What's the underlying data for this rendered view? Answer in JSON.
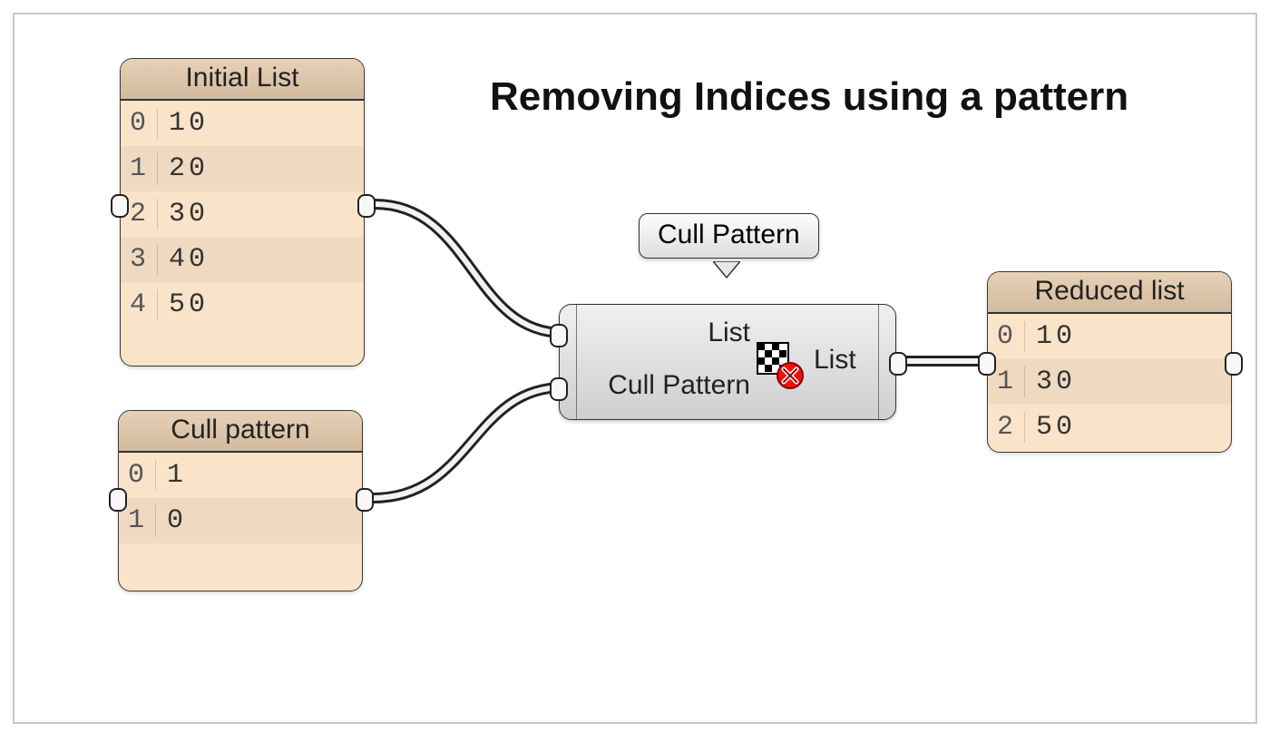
{
  "title": "Removing Indices using a pattern",
  "panels": {
    "initial": {
      "title": "Initial List",
      "rows": [
        {
          "idx": "0",
          "val": "10"
        },
        {
          "idx": "1",
          "val": "20"
        },
        {
          "idx": "2",
          "val": "30"
        },
        {
          "idx": "3",
          "val": "40"
        },
        {
          "idx": "4",
          "val": "50"
        }
      ]
    },
    "cull": {
      "title": "Cull pattern",
      "rows": [
        {
          "idx": "0",
          "val": "1"
        },
        {
          "idx": "1",
          "val": "0"
        }
      ]
    },
    "reduced": {
      "title": "Reduced list",
      "rows": [
        {
          "idx": "0",
          "val": "10"
        },
        {
          "idx": "1",
          "val": "30"
        },
        {
          "idx": "2",
          "val": "50"
        }
      ]
    }
  },
  "component": {
    "tooltip": "Cull Pattern",
    "inputs": [
      "List",
      "Cull Pattern"
    ],
    "outputs": [
      "List"
    ]
  }
}
